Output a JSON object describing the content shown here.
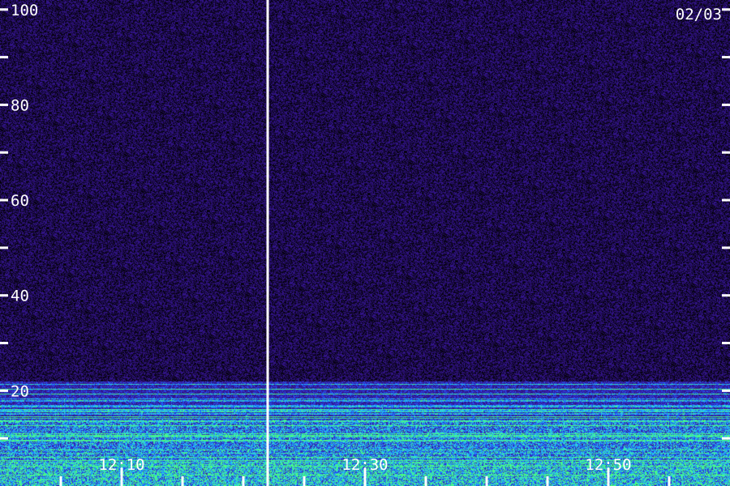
{
  "chart_data": {
    "type": "heatmap",
    "title": "",
    "xlabel": "",
    "ylabel": "",
    "date_label": "02/03",
    "y_axis": {
      "range": [
        0,
        102
      ],
      "major_ticks": [
        20,
        40,
        60,
        80,
        100
      ],
      "minor_ticks": [
        10,
        30,
        50,
        70,
        90
      ],
      "tick_labels": [
        "20",
        "40",
        "60",
        "80",
        "100"
      ]
    },
    "x_axis": {
      "time_range": [
        "12:00",
        "13:00"
      ],
      "major_tick_times": [
        "12:10",
        "12:30",
        "12:50"
      ],
      "tick_labels": [
        "12:10",
        "12:30",
        "12:50"
      ],
      "minor_tick_interval_minutes": 5
    },
    "marker_line_time": "12:22",
    "colormap": [
      "#000000",
      "#2a0f6e",
      "#3a1aa8",
      "#1e5cff",
      "#22c8ff",
      "#4cff7a"
    ],
    "description_bands": [
      {
        "low": 0,
        "high": 5,
        "intensity": 0.95
      },
      {
        "low": 5,
        "high": 14,
        "intensity": 0.75
      },
      {
        "low": 14,
        "high": 22,
        "intensity": 0.45
      },
      {
        "low": 22,
        "high": 102,
        "intensity": 0.12
      }
    ],
    "grid": false,
    "legend": "none"
  }
}
